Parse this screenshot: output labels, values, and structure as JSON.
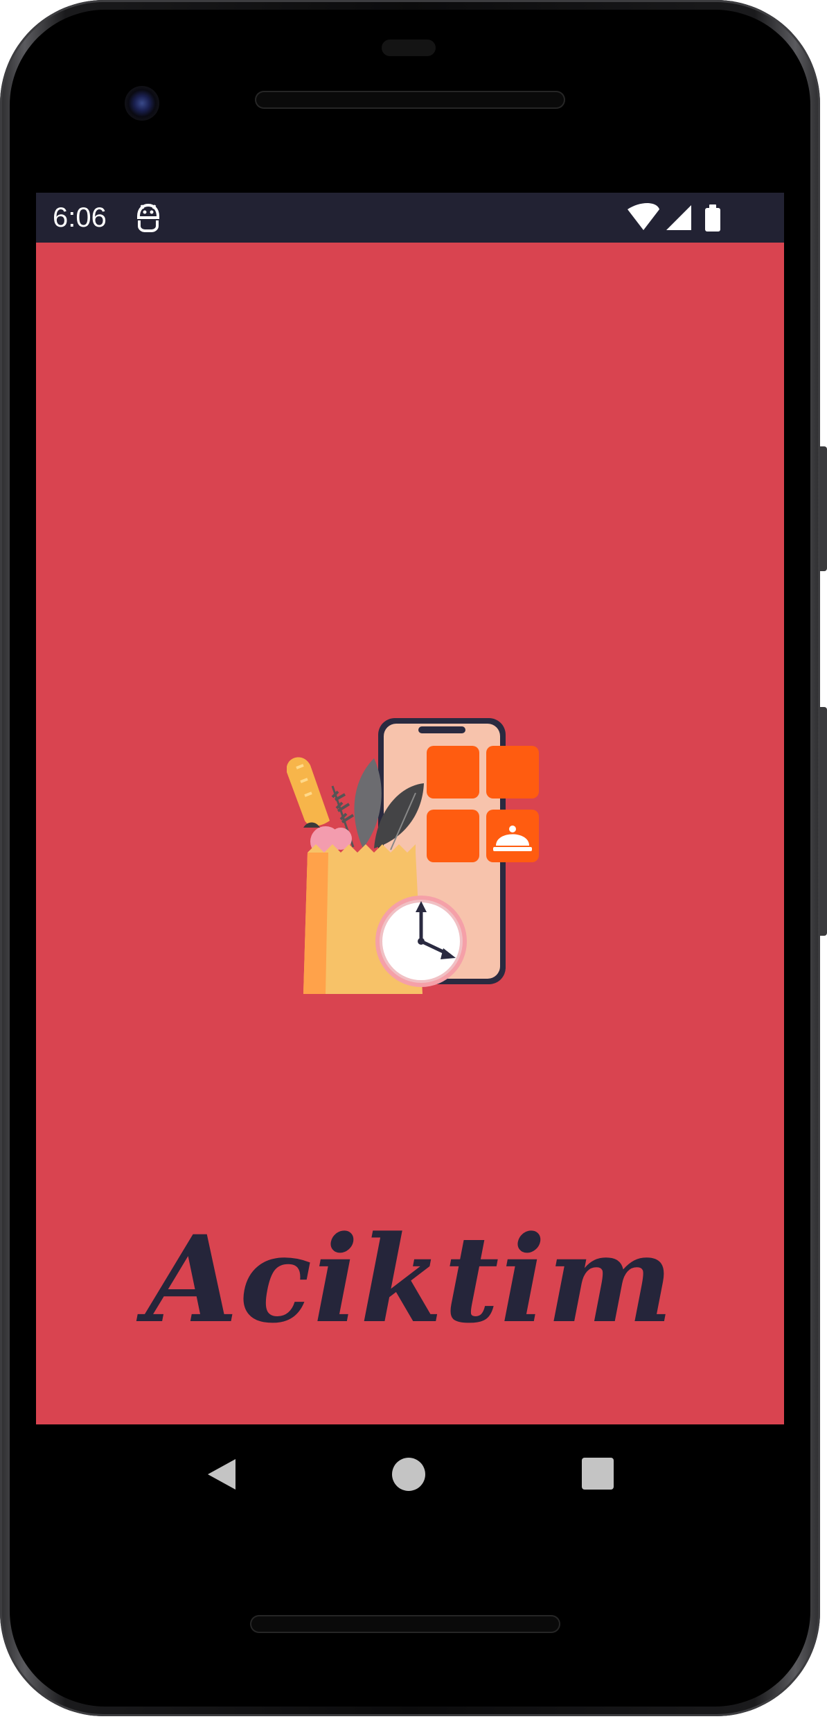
{
  "status_bar": {
    "time": "6:06",
    "icons": [
      "android-debug-icon",
      "wifi-icon",
      "signal-icon",
      "battery-icon"
    ]
  },
  "app": {
    "title": "Aciktim",
    "background_color": "#d94450",
    "title_color": "#25253a",
    "illustration": "grocery-bag-phone-clock-illustration"
  },
  "navigation": {
    "buttons": [
      "back",
      "home",
      "recents"
    ]
  }
}
